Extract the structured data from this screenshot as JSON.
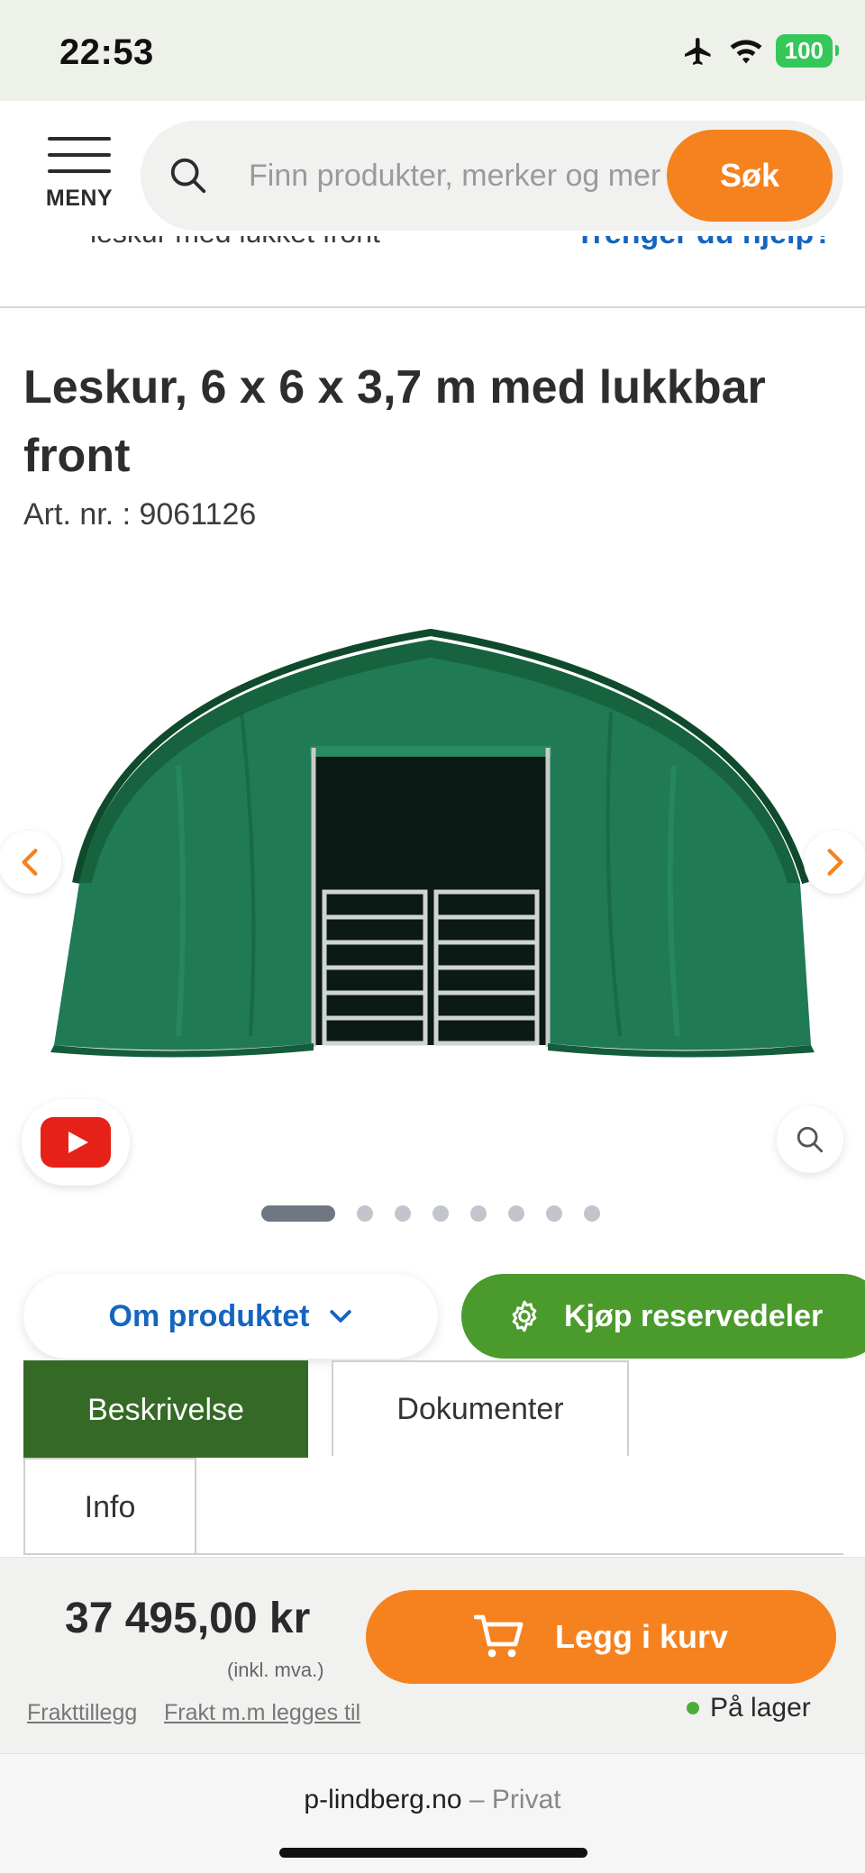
{
  "status_bar": {
    "time": "22:53",
    "battery": "100"
  },
  "header": {
    "menu_label": "MENY",
    "search_placeholder": "Finn produkter, merker og mer",
    "search_button": "Søk"
  },
  "breadcrumb_peek": {
    "crumb": "leskur med lukket front",
    "help": "Trenger du hjelp?"
  },
  "product": {
    "title": "Leskur, 6 x 6 x 3,7 m med lukkbar front",
    "art_nr": "Art. nr. : 9061126",
    "image_alt": "green-tent-shelter-with-gate",
    "gallery_count": 8,
    "gallery_active_index": 0
  },
  "actions": {
    "about_label": "Om produktet",
    "spare_parts_label": "Kjøp reservedeler"
  },
  "tabs": [
    {
      "label": "Beskrivelse",
      "active": true
    },
    {
      "label": "Dokumenter",
      "active": false
    },
    {
      "label": "Info",
      "active": false
    }
  ],
  "buy_bar": {
    "price": "37 495,00 kr",
    "vat_note": "(inkl. mva.)",
    "freight_link_1": "Frakttillegg",
    "freight_link_2": "Frakt m.m legges til",
    "cart_label": "Legg i kurv",
    "stock": "På lager"
  },
  "browser": {
    "domain": "p-lindberg.no",
    "separator": "–",
    "subtitle": "Privat"
  },
  "colors": {
    "orange": "#f5821f",
    "green": "#4b9a2c",
    "dark_green": "#346a25",
    "link_blue": "#1565c0",
    "stock_green": "#4bac3b"
  }
}
